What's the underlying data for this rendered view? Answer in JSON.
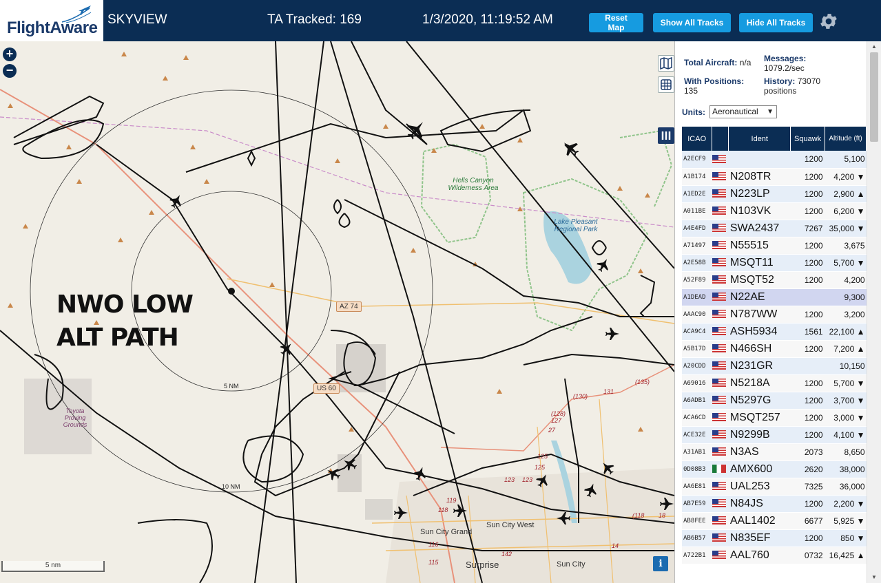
{
  "header": {
    "logo_text_1": "Flight",
    "logo_text_2": "Aware",
    "app_name": "SKYVIEW",
    "ta_tracked": "TA Tracked: 169",
    "datetime": "1/3/2020, 11:19:52 AM",
    "buttons": {
      "reset": "Reset Map",
      "show_all": "Show All Tracks",
      "hide_all": "Hide All Tracks"
    },
    "settings_icon": "gear-icon"
  },
  "map": {
    "zoom_in": "+",
    "zoom_out": "−",
    "annotation_line1": "NWO LOW",
    "annotation_line2": "ALT PATH",
    "labels": {
      "park1": "Hells Canyon Wilderness Area",
      "lake": "Lake Pleasant Regional Park",
      "area": "Toyota Proving Grounds",
      "az74": "AZ 74",
      "us60": "US 60",
      "range5": "5 NM",
      "range10": "10 NM",
      "sun_city_grand": "Sun City Grand",
      "sun_city_west": "Sun City West",
      "surprise": "Surprise",
      "sun_city": "Sun City"
    },
    "road_numbers": [
      "(135)",
      "131",
      "(130)",
      "(128)",
      "127",
      "27",
      "125",
      "125",
      "123",
      "123",
      "119",
      "118",
      "116",
      "115",
      "142",
      "14",
      "18",
      "(118"
    ],
    "scale_label": "5 nm",
    "info_btn": "i",
    "colors": {
      "land": "#f1eee6",
      "track": "#111111",
      "water": "#aad3df",
      "park_border": "#8fc48a"
    }
  },
  "sidebar": {
    "total_aircraft_label": "Total Aircraft:",
    "total_aircraft_value": "n/a",
    "with_positions_label": "With Positions:",
    "with_positions_value": "135",
    "messages_label": "Messages:",
    "messages_value": "1079.2/sec",
    "history_label": "History:",
    "history_value": "73070",
    "history_unit": "positions",
    "units_label": "Units:",
    "units_value": "Aeronautical",
    "table": {
      "headers": [
        "ICAO",
        "",
        "Ident",
        "Squawk",
        "Altitude (ft)"
      ],
      "rows": [
        {
          "icao": "A2ECF9",
          "flag": "us",
          "ident": "",
          "squawk": "1200",
          "alt": "5,100",
          "trend": ""
        },
        {
          "icao": "A1B174",
          "flag": "us",
          "ident": "N208TR",
          "squawk": "1200",
          "alt": "4,200",
          "trend": "▼"
        },
        {
          "icao": "A1ED2E",
          "flag": "us",
          "ident": "N223LP",
          "squawk": "1200",
          "alt": "2,900",
          "trend": "▲"
        },
        {
          "icao": "A011BE",
          "flag": "us",
          "ident": "N103VK",
          "squawk": "1200",
          "alt": "6,200",
          "trend": "▼"
        },
        {
          "icao": "A4E4FD",
          "flag": "us",
          "ident": "SWA2437",
          "squawk": "7267",
          "alt": "35,000",
          "trend": "▼"
        },
        {
          "icao": "A71497",
          "flag": "us",
          "ident": "N55515",
          "squawk": "1200",
          "alt": "3,675",
          "trend": ""
        },
        {
          "icao": "A2E58B",
          "flag": "us",
          "ident": "MSQT11",
          "squawk": "1200",
          "alt": "5,700",
          "trend": "▼"
        },
        {
          "icao": "A52F89",
          "flag": "us",
          "ident": "MSQT52",
          "squawk": "1200",
          "alt": "4,200",
          "trend": ""
        },
        {
          "icao": "A1DEAD",
          "flag": "us",
          "ident": "N22AE",
          "squawk": "",
          "alt": "9,300",
          "trend": ""
        },
        {
          "icao": "AAAC90",
          "flag": "us",
          "ident": "N787WW",
          "squawk": "1200",
          "alt": "3,200",
          "trend": ""
        },
        {
          "icao": "ACA9C4",
          "flag": "us",
          "ident": "ASH5934",
          "squawk": "1561",
          "alt": "22,100",
          "trend": "▲"
        },
        {
          "icao": "A5B17D",
          "flag": "us",
          "ident": "N466SH",
          "squawk": "1200",
          "alt": "7,200",
          "trend": "▲"
        },
        {
          "icao": "A20CDD",
          "flag": "us",
          "ident": "N231GR",
          "squawk": "",
          "alt": "10,150",
          "trend": ""
        },
        {
          "icao": "A69016",
          "flag": "us",
          "ident": "N5218A",
          "squawk": "1200",
          "alt": "5,700",
          "trend": "▼"
        },
        {
          "icao": "A6ADB1",
          "flag": "us",
          "ident": "N5297G",
          "squawk": "1200",
          "alt": "3,700",
          "trend": "▼"
        },
        {
          "icao": "ACA6CD",
          "flag": "us",
          "ident": "MSQT257",
          "squawk": "1200",
          "alt": "3,000",
          "trend": "▼"
        },
        {
          "icao": "ACE32E",
          "flag": "us",
          "ident": "N9299B",
          "squawk": "1200",
          "alt": "4,100",
          "trend": "▼"
        },
        {
          "icao": "A31AB1",
          "flag": "us",
          "ident": "N3AS",
          "squawk": "2073",
          "alt": "8,650",
          "trend": ""
        },
        {
          "icao": "0D08B3",
          "flag": "mx",
          "ident": "AMX600",
          "squawk": "2620",
          "alt": "38,000",
          "trend": ""
        },
        {
          "icao": "AA6E81",
          "flag": "us",
          "ident": "UAL253",
          "squawk": "7325",
          "alt": "36,000",
          "trend": ""
        },
        {
          "icao": "AB7E59",
          "flag": "us",
          "ident": "N84JS",
          "squawk": "1200",
          "alt": "2,200",
          "trend": "▼"
        },
        {
          "icao": "AB8FEE",
          "flag": "us",
          "ident": "AAL1402",
          "squawk": "6677",
          "alt": "5,925",
          "trend": "▼"
        },
        {
          "icao": "AB6B57",
          "flag": "us",
          "ident": "N835EF",
          "squawk": "1200",
          "alt": "850",
          "trend": "▼"
        },
        {
          "icao": "A722B1",
          "flag": "us",
          "ident": "AAL760",
          "squawk": "0732",
          "alt": "16,425",
          "trend": "▲"
        }
      ],
      "selected_index": 8
    }
  }
}
